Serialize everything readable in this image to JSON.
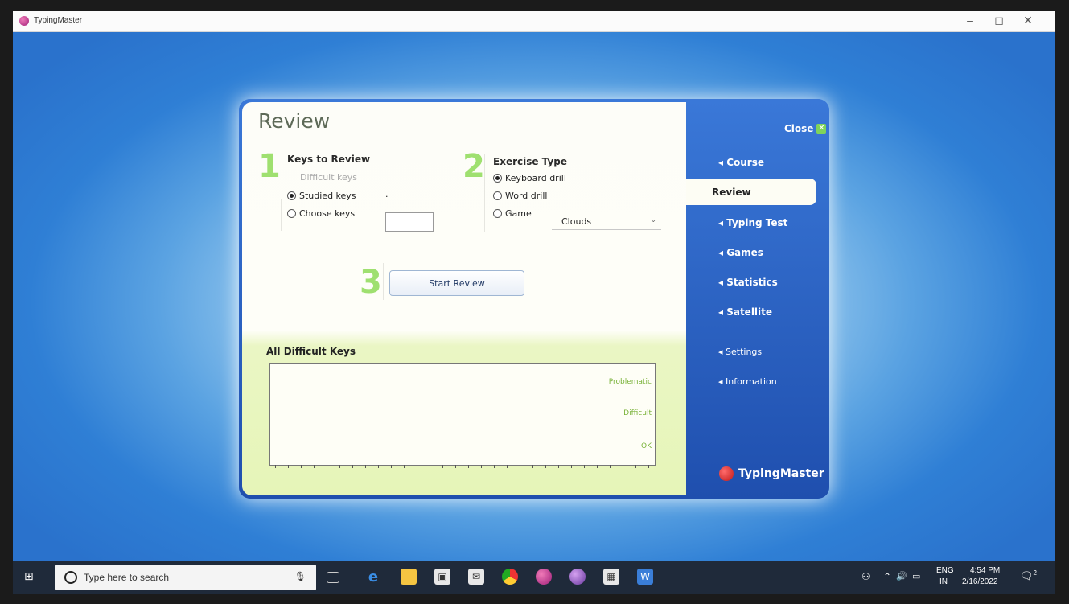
{
  "window": {
    "title": "TypingMaster",
    "minimize": "–",
    "maximize": "◻",
    "close": "✕"
  },
  "review": {
    "title": "Review",
    "step1": {
      "number": "1",
      "heading": "Keys to Review",
      "options": [
        {
          "label": "Difficult keys",
          "selected": false,
          "disabled": true
        },
        {
          "label": "Studied keys",
          "selected": true,
          "disabled": false
        },
        {
          "label": "Choose keys",
          "selected": false,
          "disabled": false
        }
      ],
      "dot": "."
    },
    "step2": {
      "number": "2",
      "heading": "Exercise Type",
      "options": [
        {
          "label": "Keyboard drill",
          "selected": true
        },
        {
          "label": "Word drill",
          "selected": false
        },
        {
          "label": "Game",
          "selected": false
        }
      ],
      "game_select": "Clouds"
    },
    "step3": {
      "number": "3",
      "button": "Start Review"
    },
    "difficult_keys": {
      "heading": "All Difficult Keys",
      "bands": [
        "Problematic",
        "Difficult",
        "OK"
      ]
    }
  },
  "sidebar": {
    "close": "Close",
    "items": [
      {
        "label": "Course",
        "active": false
      },
      {
        "label": "Review",
        "active": true
      },
      {
        "label": "Typing Test",
        "active": false
      },
      {
        "label": "Games",
        "active": false
      },
      {
        "label": "Statistics",
        "active": false
      },
      {
        "label": "Satellite",
        "active": false
      },
      {
        "label": "Settings",
        "active": false
      },
      {
        "label": "Information",
        "active": false
      }
    ],
    "brand": "TypingMaster"
  },
  "taskbar": {
    "search_placeholder": "Type here to search",
    "language": "ENG",
    "region": "IN",
    "time": "4:54 PM",
    "date": "2/16/2022",
    "notification_count": "2"
  }
}
